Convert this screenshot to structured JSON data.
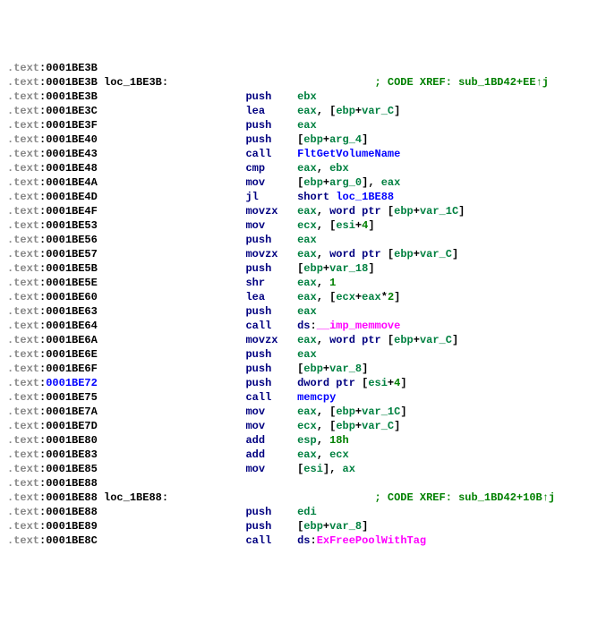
{
  "lines": [
    {
      "addr": "0001BE3B",
      "blue": false,
      "label": "",
      "xref": "",
      "cols": [
        "",
        "",
        ""
      ]
    },
    {
      "addr": "0001BE3B",
      "blue": false,
      "label": "loc_1BE3B:",
      "xref": "; CODE XREF: sub_1BD42+EE↑j",
      "cols": [
        "",
        "",
        ""
      ]
    },
    {
      "addr": "0001BE3B",
      "blue": false,
      "label": "",
      "xref": "",
      "mnem": "push",
      "op": [
        {
          "t": "reg",
          "v": "ebx"
        }
      ]
    },
    {
      "addr": "0001BE3C",
      "blue": false,
      "label": "",
      "xref": "",
      "mnem": "lea",
      "op": [
        {
          "t": "reg",
          "v": "eax"
        },
        {
          "t": "p",
          "v": ", ["
        },
        {
          "t": "reg",
          "v": "ebp"
        },
        {
          "t": "p",
          "v": "+"
        },
        {
          "t": "sym",
          "v": "var_C"
        },
        {
          "t": "p",
          "v": "]"
        }
      ]
    },
    {
      "addr": "0001BE3F",
      "blue": false,
      "label": "",
      "xref": "",
      "mnem": "push",
      "op": [
        {
          "t": "reg",
          "v": "eax"
        }
      ]
    },
    {
      "addr": "0001BE40",
      "blue": false,
      "label": "",
      "xref": "",
      "mnem": "push",
      "op": [
        {
          "t": "p",
          "v": "["
        },
        {
          "t": "reg",
          "v": "ebp"
        },
        {
          "t": "p",
          "v": "+"
        },
        {
          "t": "sym",
          "v": "arg_4"
        },
        {
          "t": "p",
          "v": "]"
        }
      ]
    },
    {
      "addr": "0001BE43",
      "blue": false,
      "label": "",
      "xref": "",
      "mnem": "call",
      "op": [
        {
          "t": "func",
          "v": "FltGetVolumeName"
        }
      ]
    },
    {
      "addr": "0001BE48",
      "blue": false,
      "label": "",
      "xref": "",
      "mnem": "cmp",
      "op": [
        {
          "t": "reg",
          "v": "eax"
        },
        {
          "t": "p",
          "v": ", "
        },
        {
          "t": "reg",
          "v": "ebx"
        }
      ]
    },
    {
      "addr": "0001BE4A",
      "blue": false,
      "label": "",
      "xref": "",
      "mnem": "mov",
      "op": [
        {
          "t": "p",
          "v": "["
        },
        {
          "t": "reg",
          "v": "ebp"
        },
        {
          "t": "p",
          "v": "+"
        },
        {
          "t": "sym",
          "v": "arg_0"
        },
        {
          "t": "p",
          "v": "], "
        },
        {
          "t": "reg",
          "v": "eax"
        }
      ]
    },
    {
      "addr": "0001BE4D",
      "blue": false,
      "label": "",
      "xref": "",
      "mnem": "jl",
      "op": [
        {
          "t": "key",
          "v": "short"
        },
        {
          "t": "p",
          "v": " "
        },
        {
          "t": "func",
          "v": "loc_1BE88"
        }
      ]
    },
    {
      "addr": "0001BE4F",
      "blue": false,
      "label": "",
      "xref": "",
      "mnem": "movzx",
      "op": [
        {
          "t": "reg",
          "v": "eax"
        },
        {
          "t": "p",
          "v": ", "
        },
        {
          "t": "key",
          "v": "word ptr"
        },
        {
          "t": "p",
          "v": " ["
        },
        {
          "t": "reg",
          "v": "ebp"
        },
        {
          "t": "p",
          "v": "+"
        },
        {
          "t": "sym",
          "v": "var_1C"
        },
        {
          "t": "p",
          "v": "]"
        }
      ]
    },
    {
      "addr": "0001BE53",
      "blue": false,
      "label": "",
      "xref": "",
      "mnem": "mov",
      "op": [
        {
          "t": "reg",
          "v": "ecx"
        },
        {
          "t": "p",
          "v": ", ["
        },
        {
          "t": "reg",
          "v": "esi"
        },
        {
          "t": "p",
          "v": "+"
        },
        {
          "t": "num",
          "v": "4"
        },
        {
          "t": "p",
          "v": "]"
        }
      ]
    },
    {
      "addr": "0001BE56",
      "blue": false,
      "label": "",
      "xref": "",
      "mnem": "push",
      "op": [
        {
          "t": "reg",
          "v": "eax"
        }
      ]
    },
    {
      "addr": "0001BE57",
      "blue": false,
      "label": "",
      "xref": "",
      "mnem": "movzx",
      "op": [
        {
          "t": "reg",
          "v": "eax"
        },
        {
          "t": "p",
          "v": ", "
        },
        {
          "t": "key",
          "v": "word ptr"
        },
        {
          "t": "p",
          "v": " ["
        },
        {
          "t": "reg",
          "v": "ebp"
        },
        {
          "t": "p",
          "v": "+"
        },
        {
          "t": "sym",
          "v": "var_C"
        },
        {
          "t": "p",
          "v": "]"
        }
      ]
    },
    {
      "addr": "0001BE5B",
      "blue": false,
      "label": "",
      "xref": "",
      "mnem": "push",
      "op": [
        {
          "t": "p",
          "v": "["
        },
        {
          "t": "reg",
          "v": "ebp"
        },
        {
          "t": "p",
          "v": "+"
        },
        {
          "t": "sym",
          "v": "var_18"
        },
        {
          "t": "p",
          "v": "]"
        }
      ]
    },
    {
      "addr": "0001BE5E",
      "blue": false,
      "label": "",
      "xref": "",
      "mnem": "shr",
      "op": [
        {
          "t": "reg",
          "v": "eax"
        },
        {
          "t": "p",
          "v": ", "
        },
        {
          "t": "num",
          "v": "1"
        }
      ]
    },
    {
      "addr": "0001BE60",
      "blue": false,
      "label": "",
      "xref": "",
      "mnem": "lea",
      "op": [
        {
          "t": "reg",
          "v": "eax"
        },
        {
          "t": "p",
          "v": ", ["
        },
        {
          "t": "reg",
          "v": "ecx"
        },
        {
          "t": "p",
          "v": "+"
        },
        {
          "t": "reg",
          "v": "eax"
        },
        {
          "t": "p",
          "v": "*"
        },
        {
          "t": "num",
          "v": "2"
        },
        {
          "t": "p",
          "v": "]"
        }
      ]
    },
    {
      "addr": "0001BE63",
      "blue": false,
      "label": "",
      "xref": "",
      "mnem": "push",
      "op": [
        {
          "t": "reg",
          "v": "eax"
        }
      ]
    },
    {
      "addr": "0001BE64",
      "blue": false,
      "label": "",
      "xref": "",
      "mnem": "call",
      "op": [
        {
          "t": "key",
          "v": "ds"
        },
        {
          "t": "p",
          "v": ":"
        },
        {
          "t": "imp",
          "v": "__imp_memmove"
        }
      ]
    },
    {
      "addr": "0001BE6A",
      "blue": false,
      "label": "",
      "xref": "",
      "mnem": "movzx",
      "op": [
        {
          "t": "reg",
          "v": "eax"
        },
        {
          "t": "p",
          "v": ", "
        },
        {
          "t": "key",
          "v": "word ptr"
        },
        {
          "t": "p",
          "v": " ["
        },
        {
          "t": "reg",
          "v": "ebp"
        },
        {
          "t": "p",
          "v": "+"
        },
        {
          "t": "sym",
          "v": "var_C"
        },
        {
          "t": "p",
          "v": "]"
        }
      ]
    },
    {
      "addr": "0001BE6E",
      "blue": false,
      "label": "",
      "xref": "",
      "mnem": "push",
      "op": [
        {
          "t": "reg",
          "v": "eax"
        }
      ]
    },
    {
      "addr": "0001BE6F",
      "blue": false,
      "label": "",
      "xref": "",
      "mnem": "push",
      "op": [
        {
          "t": "p",
          "v": "["
        },
        {
          "t": "reg",
          "v": "ebp"
        },
        {
          "t": "p",
          "v": "+"
        },
        {
          "t": "sym",
          "v": "var_8"
        },
        {
          "t": "p",
          "v": "]"
        }
      ]
    },
    {
      "addr": "0001BE72",
      "blue": true,
      "label": "",
      "xref": "",
      "mnem": "push",
      "op": [
        {
          "t": "key",
          "v": "dword ptr"
        },
        {
          "t": "p",
          "v": " ["
        },
        {
          "t": "reg",
          "v": "esi"
        },
        {
          "t": "p",
          "v": "+"
        },
        {
          "t": "num",
          "v": "4"
        },
        {
          "t": "p",
          "v": "]"
        }
      ]
    },
    {
      "addr": "0001BE75",
      "blue": false,
      "label": "",
      "xref": "",
      "mnem": "call",
      "op": [
        {
          "t": "func",
          "v": "memcpy"
        }
      ]
    },
    {
      "addr": "0001BE7A",
      "blue": false,
      "label": "",
      "xref": "",
      "mnem": "mov",
      "op": [
        {
          "t": "reg",
          "v": "eax"
        },
        {
          "t": "p",
          "v": ", ["
        },
        {
          "t": "reg",
          "v": "ebp"
        },
        {
          "t": "p",
          "v": "+"
        },
        {
          "t": "sym",
          "v": "var_1C"
        },
        {
          "t": "p",
          "v": "]"
        }
      ]
    },
    {
      "addr": "0001BE7D",
      "blue": false,
      "label": "",
      "xref": "",
      "mnem": "mov",
      "op": [
        {
          "t": "reg",
          "v": "ecx"
        },
        {
          "t": "p",
          "v": ", ["
        },
        {
          "t": "reg",
          "v": "ebp"
        },
        {
          "t": "p",
          "v": "+"
        },
        {
          "t": "sym",
          "v": "var_C"
        },
        {
          "t": "p",
          "v": "]"
        }
      ]
    },
    {
      "addr": "0001BE80",
      "blue": false,
      "label": "",
      "xref": "",
      "mnem": "add",
      "op": [
        {
          "t": "reg",
          "v": "esp"
        },
        {
          "t": "p",
          "v": ", "
        },
        {
          "t": "num",
          "v": "18h"
        }
      ]
    },
    {
      "addr": "0001BE83",
      "blue": false,
      "label": "",
      "xref": "",
      "mnem": "add",
      "op": [
        {
          "t": "reg",
          "v": "eax"
        },
        {
          "t": "p",
          "v": ", "
        },
        {
          "t": "reg",
          "v": "ecx"
        }
      ]
    },
    {
      "addr": "0001BE85",
      "blue": false,
      "label": "",
      "xref": "",
      "mnem": "mov",
      "op": [
        {
          "t": "p",
          "v": "["
        },
        {
          "t": "reg",
          "v": "esi"
        },
        {
          "t": "p",
          "v": "], "
        },
        {
          "t": "reg",
          "v": "ax"
        }
      ]
    },
    {
      "addr": "0001BE88",
      "blue": false,
      "label": "",
      "xref": "",
      "cols": [
        "",
        "",
        ""
      ]
    },
    {
      "addr": "0001BE88",
      "blue": false,
      "label": "loc_1BE88:",
      "xref": "; CODE XREF: sub_1BD42+10B↑j",
      "cols": [
        "",
        "",
        ""
      ]
    },
    {
      "addr": "0001BE88",
      "blue": false,
      "label": "",
      "xref": "",
      "mnem": "push",
      "op": [
        {
          "t": "reg",
          "v": "edi"
        }
      ]
    },
    {
      "addr": "0001BE89",
      "blue": false,
      "label": "",
      "xref": "",
      "mnem": "push",
      "op": [
        {
          "t": "p",
          "v": "["
        },
        {
          "t": "reg",
          "v": "ebp"
        },
        {
          "t": "p",
          "v": "+"
        },
        {
          "t": "sym",
          "v": "var_8"
        },
        {
          "t": "p",
          "v": "]"
        }
      ]
    },
    {
      "addr": "0001BE8C",
      "blue": false,
      "label": "",
      "xref": "",
      "mnem": "call",
      "op": [
        {
          "t": "key",
          "v": "ds"
        },
        {
          "t": "p",
          "v": ":"
        },
        {
          "t": "imp",
          "v": "ExFreePoolWithTag"
        }
      ]
    }
  ],
  "seg": ".text",
  "mnem_col": 37,
  "op_col": 45,
  "xref_col": 57
}
